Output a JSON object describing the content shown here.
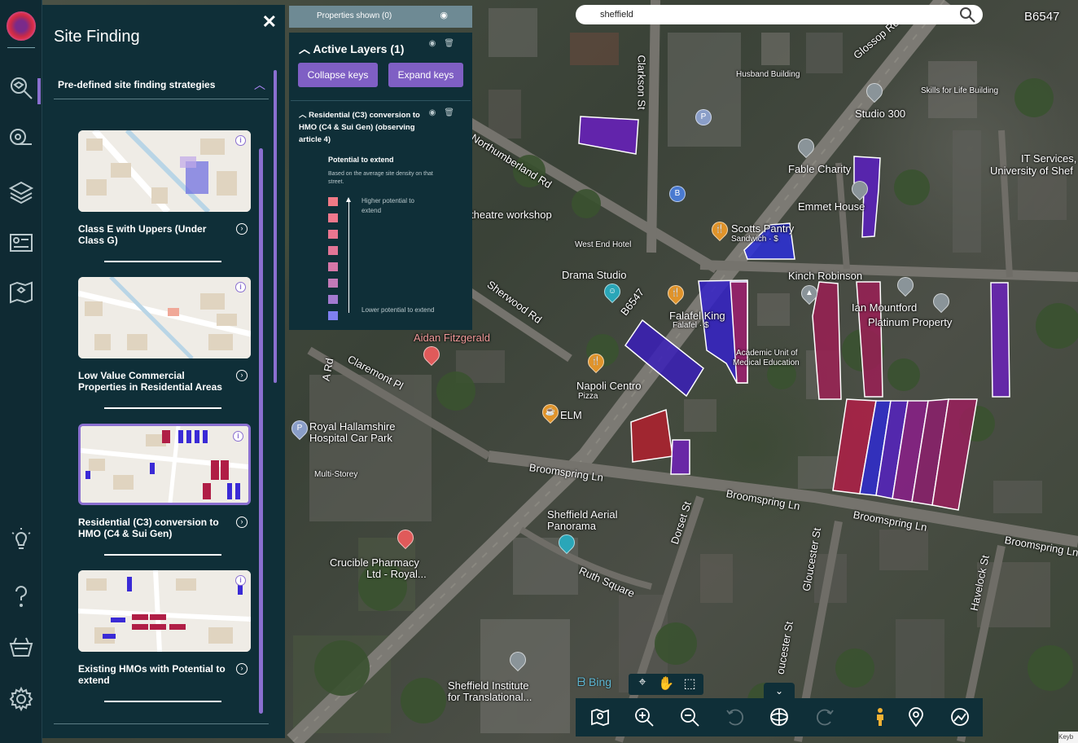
{
  "panel": {
    "title": "Site Finding",
    "close_label": "✕",
    "section_label": "Pre-defined site finding strategies",
    "cards": [
      {
        "title": "Class E with Uppers (Under Class G)"
      },
      {
        "title": "Low Value Commercial Properties in Residential Areas"
      },
      {
        "title": "Residential (C3) conversion to HMO (C4 & Sui Gen)"
      },
      {
        "title": "Existing HMOs with Potential to extend"
      }
    ],
    "info_glyph": "i",
    "go_glyph": "›"
  },
  "layers": {
    "properties_shown": "Properties shown (0)",
    "active_layers": "Active Layers (1)",
    "collapse_keys": "Collapse keys",
    "expand_keys": "Expand keys",
    "layer_name": "Residential (C3) conversion to HMO (C4 & Sui Gen) (observing article 4)",
    "legend_title": "Potential to extend",
    "legend_desc": "Based on the average site density on that street.",
    "legend_high": "Higher potential to extend",
    "legend_low": "Lower potential to extend",
    "legend_colors": [
      "#f07a86",
      "#f0788c",
      "#ea7690",
      "#e27596",
      "#d677a8",
      "#c37ab8",
      "#a37ad0",
      "#7f7ff0"
    ]
  },
  "search": {
    "value": "sheffield"
  },
  "map": {
    "labels": {
      "b6547_top": "B6547",
      "husband_building": "Husband Building",
      "skills_for_life": "Skills for Life Building",
      "studio_300": "Studio 300",
      "fable_charity": "Fable Charity",
      "it_services": "IT Services,",
      "university_of_shef": "University of Shef",
      "emmet_house": "Emmet House",
      "theatre_workshop": "theatre workshop",
      "scotts_pantry": "Scotts Pantry",
      "sandwich": "Sandwich · $",
      "west_end_hotel": "West End Hotel",
      "drama_studio": "Drama Studio",
      "kinch_robinson": "Kinch Robinson",
      "mountford": "Ian Mountford",
      "platinum_property": "Platinum Property",
      "falafel_king": "Falafel King",
      "falafel_sub": "Falafel · $",
      "academic_unit": "Academic Unit of",
      "medical_education": "Medical Education",
      "aidan_fitzgerald": "Aidan Fitzgerald",
      "napoli_centro": "Napoli Centro",
      "pizza": "Pizza",
      "elm": "ELM",
      "royal_hallamshire": "Royal Hallamshire",
      "hospital_car_park": "Hospital Car Park",
      "multi_storey": "Multi-Storey",
      "sheffield_aerial": "Sheffield Aerial",
      "panorama": "Panorama",
      "crucible_pharmacy": "Crucible Pharmacy",
      "ltd_royal": "Ltd - Royal...",
      "sheffield_institute": "Sheffield Institute",
      "for_translational": "for Translational...",
      "rd_label": "Rd",
      "ard": "A Rd"
    },
    "roads": {
      "glossop_rd": "Glossop Rd",
      "northumberland_rd": "Northumberland Rd",
      "clarkson_st": "Clarkson St",
      "sherwood_rd": "Sherwood Rd",
      "b6547_mid": "B6547",
      "claremont_pl": "Claremont Pl",
      "broomspring_ln_1": "Broomspring Ln",
      "broomspring_ln_2": "Broomspring Ln",
      "broomspring_ln_3": "Broomspring Ln",
      "broomspring_ln_4": "Broomspring Ln",
      "dorset_st": "Dorset St",
      "gloucester_st": "Gloucester St",
      "havelock_st": "Havelock St",
      "ruth_square": "Ruth Square",
      "rd_short": "Rd",
      "oucester_st": "oucester St"
    },
    "attribution": "Bing",
    "keyboard": "Keyb"
  },
  "toolbar": {
    "toggle_glyph": "⌄"
  }
}
